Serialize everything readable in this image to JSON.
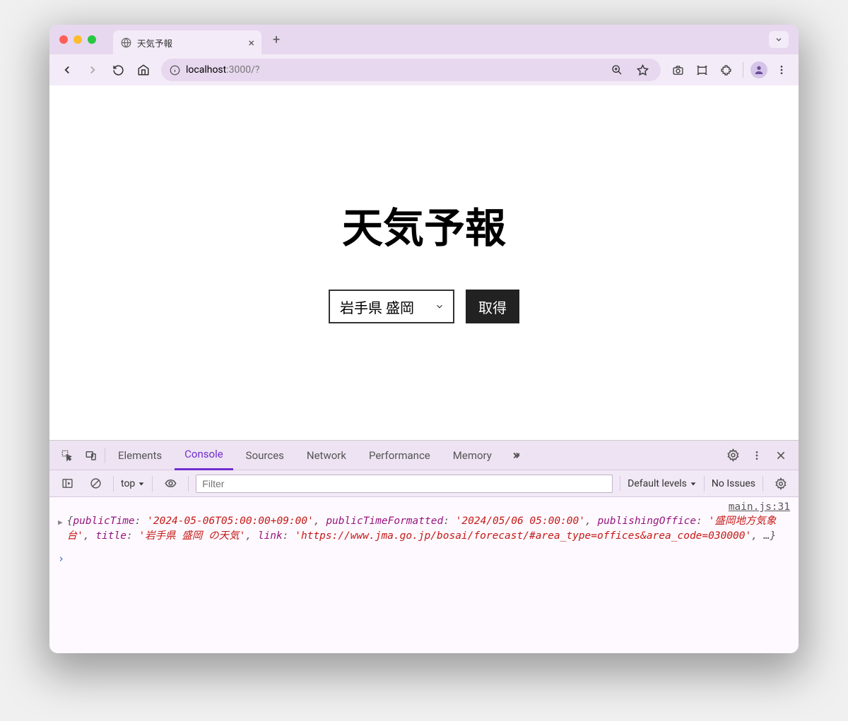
{
  "tab": {
    "title": "天気予報"
  },
  "url": {
    "host": "localhost",
    "path": ":3000/?"
  },
  "page": {
    "heading": "天気予報",
    "select_value": "岩手県 盛岡",
    "fetch_label": "取得"
  },
  "devtools": {
    "tabs": {
      "elements": "Elements",
      "console": "Console",
      "sources": "Sources",
      "network": "Network",
      "performance": "Performance",
      "memory": "Memory"
    },
    "toolbar": {
      "context": "top",
      "filter_placeholder": "Filter",
      "levels": "Default levels",
      "issues": "No Issues"
    },
    "console": {
      "source": "main.js:31",
      "object": {
        "publicTime_key": "publicTime",
        "publicTime_val": "'2024-05-06T05:00:00+09:00'",
        "publicTimeFormatted_key": "publicTimeFormatted",
        "publicTimeFormatted_val": "'2024/05/06 05:00:00'",
        "publishingOffice_key": "publishingOffice",
        "publishingOffice_val": "'盛岡地方気象台'",
        "title_key": "title",
        "title_val": "'岩手県 盛岡 の天気'",
        "link_key": "link",
        "link_val": "'https://www.jma.go.jp/bosai/forecast/#area_type=offices&area_code=030000'",
        "ellipsis": "…"
      }
    }
  }
}
